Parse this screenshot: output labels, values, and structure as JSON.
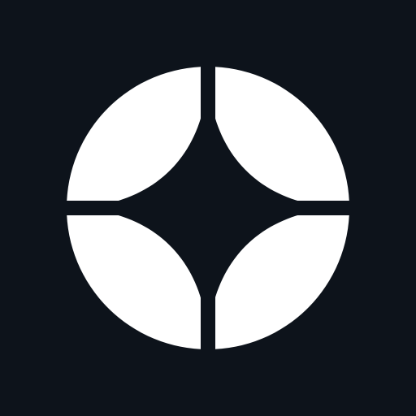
{
  "app_icon": {
    "icon_name": "four-point-star-circle-logo-icon",
    "background_color": "#0d131b",
    "foreground_color": "#ffffff"
  }
}
